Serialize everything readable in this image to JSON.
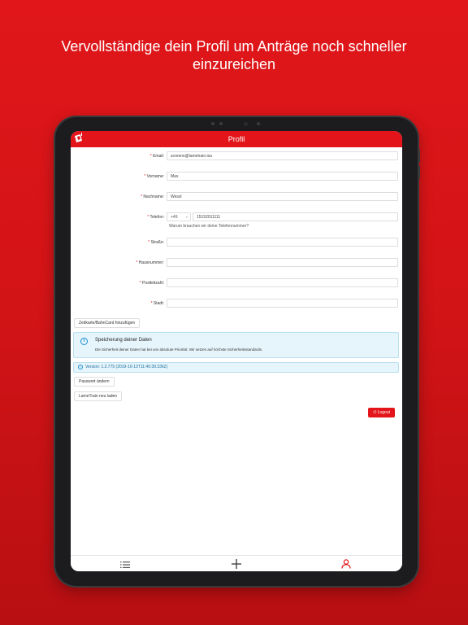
{
  "headline": {
    "line1": "Vervollständige dein Profil um Anträge noch schneller",
    "line2": "einzureichen"
  },
  "nav": {
    "title": "Profil",
    "logo_icon": "app-logo-icon"
  },
  "form": {
    "required_mark": "*",
    "fields": {
      "email": {
        "label": "Email:",
        "value": "screens@lametrain.iou"
      },
      "vorname": {
        "label": "Vorname:",
        "value": "Max"
      },
      "nachname": {
        "label": "Nachname:",
        "value": "Wessl"
      },
      "telefon": {
        "label": "Telefon:",
        "country_code": "+49",
        "value": "15152011111",
        "hint": "Warum brauchen wir deine Telefonnummer?"
      },
      "strasse": {
        "label": "Straße:",
        "value": ""
      },
      "hausnummer": {
        "label": "Hausnummer:",
        "value": ""
      },
      "postleitzahl": {
        "label": "Postleitzahl:",
        "value": ""
      },
      "stadt": {
        "label": "Stadt:",
        "value": ""
      }
    }
  },
  "buttons": {
    "add_card": "Zeitkarte/BahnCard hinzufügen",
    "change_password": "Passwort ändern",
    "reload": "LameTrain neu laden",
    "logout": "Logout"
  },
  "info": {
    "title": "Speicherung deiner Daten",
    "text": "Die Sicherheit deiner Daten hat bei uns absolute Priorität. Wir setzen auf höchste Sicherheitsstandards.",
    "icon": "info-icon"
  },
  "version": {
    "text": "Version: 1.2.775 (2019-10-13T11:40:39.336Z)"
  },
  "tabbar": {
    "items": [
      "list-icon",
      "plus-icon",
      "user-icon"
    ]
  },
  "colors": {
    "brand_red": "#e3151a",
    "info_blue": "#1a8fd0",
    "info_bg": "#e6f4fb"
  }
}
